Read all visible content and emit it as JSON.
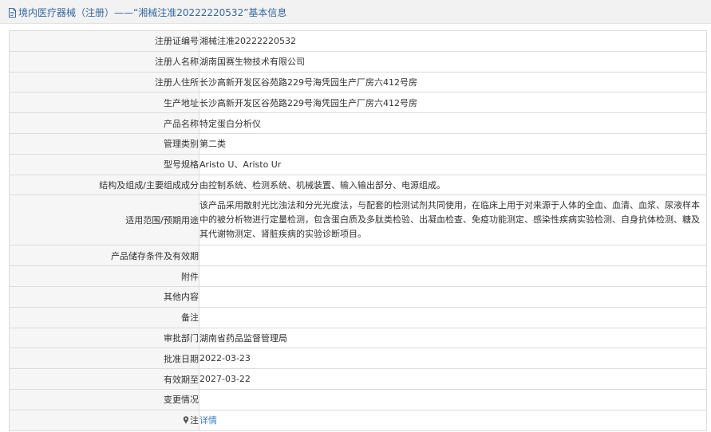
{
  "header": {
    "title": "境内医疗器械（注册）——“湘械注准20222220532”基本信息",
    "icon": "document-icon"
  },
  "colors": {
    "header_text": "#34689c",
    "label_bg": "#f6f6f6",
    "border": "#dcdcdc",
    "link": "#3b7cc2"
  },
  "rows": [
    {
      "label": "注册证编号",
      "value": "湘械注准20222220532"
    },
    {
      "label": "注册人名称",
      "value": "湖南国赛生物技术有限公司"
    },
    {
      "label": "注册人住所",
      "value": "长沙高新开发区谷苑路229号海凭园生产厂房六412号房"
    },
    {
      "label": "生产地址",
      "value": "长沙高新开发区谷苑路229号海凭园生产厂房六412号房"
    },
    {
      "label": "产品名称",
      "value": "特定蛋白分析仪"
    },
    {
      "label": "管理类别",
      "value": "第二类"
    },
    {
      "label": "型号规格",
      "value": "Aristo U、Aristo Ur"
    },
    {
      "label": "结构及组成/主要组成成分",
      "value": "由控制系统、检测系统、机械装置、输入输出部分、电源组成。"
    },
    {
      "label": "适用范围/预期用途",
      "value": "该产品采用散射光比浊法和分光光度法，与配套的检测试剂共同使用，在临床上用于对来源于人体的全血、血清、血浆、尿液样本中的被分析物进行定量检测，包含蛋白质及多肽类检验、出凝血检查、免疫功能测定、感染性疾病实验检测、自身抗体检测、糖及其代谢物测定、肾脏疾病的实验诊断项目。"
    },
    {
      "label": "产品储存条件及有效期",
      "value": ""
    },
    {
      "label": "附件",
      "value": ""
    },
    {
      "label": "其他内容",
      "value": ""
    },
    {
      "label": "备注",
      "value": ""
    },
    {
      "label": "审批部门",
      "value": "湖南省药品监督管理局"
    },
    {
      "label": "批准日期",
      "value": "2022-03-23"
    },
    {
      "label": "有效期至",
      "value": "2027-03-22"
    },
    {
      "label": "变更情况",
      "value": ""
    },
    {
      "label": "注",
      "value": "详情",
      "icon": "pin-icon"
    }
  ]
}
